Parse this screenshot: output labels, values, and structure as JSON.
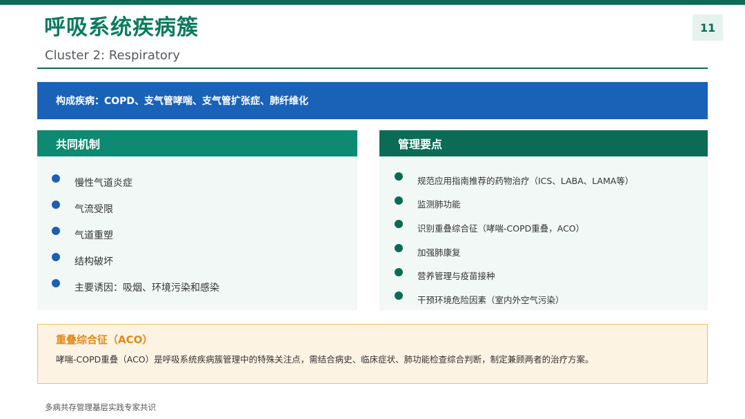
{
  "header": {
    "title": "呼吸系统疾病簇",
    "subtitle": "Cluster 2: Respiratory",
    "page_number": "11"
  },
  "banner": {
    "text": "构成疾病：COPD、支气管哮喘、支气管扩张症、肺纤维化"
  },
  "mechanism": {
    "title": "共同机制",
    "items": [
      "慢性气道炎症",
      "气流受限",
      "气道重塑",
      "结构破坏",
      "主要诱因：吸烟、环境污染和感染"
    ]
  },
  "management": {
    "title": "管理要点",
    "items": [
      "规范应用指南推荐的药物治疗（ICS、LABA、LAMA等）",
      "监测肺功能",
      "识别重叠综合征（哮喘-COPD重叠，ACO）",
      "加强肺康复",
      "营养管理与疫苗接种",
      "干预环境危险因素（室内外空气污染）"
    ]
  },
  "aco": {
    "title": "重叠综合征（ACO）",
    "text": "哮喘-COPD重叠（ACO）是呼吸系统疾病簇管理中的特殊关注点，需结合病史、临床症状、肺功能检查综合判断，制定兼顾两者的治疗方案。"
  },
  "footer": {
    "source": "多病共存管理基层实践专家共识"
  },
  "colors": {
    "brand_green": "#0b6b55",
    "mechanism_header": "#0e8a72",
    "banner_blue": "#1a62b8",
    "bullet_blue": "#1e5eb4",
    "aco_orange": "#e08a1a",
    "aco_border": "#f0c060"
  }
}
